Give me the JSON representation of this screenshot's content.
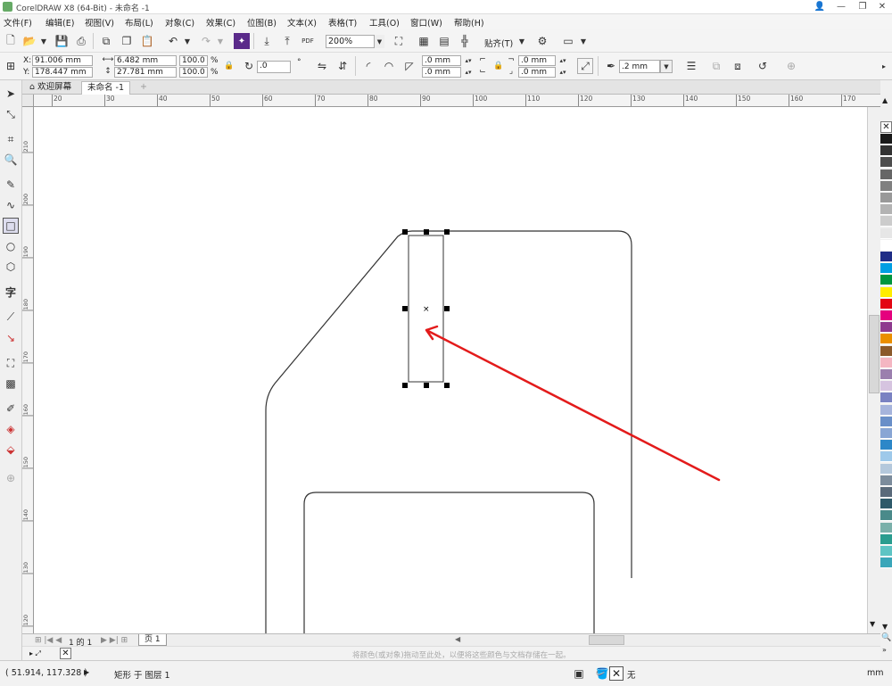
{
  "window": {
    "title": "CorelDRAW X8 (64-Bit) - 未命名 -1"
  },
  "menu": [
    "文件(F)",
    "编辑(E)",
    "视图(V)",
    "布局(L)",
    "对象(C)",
    "效果(C)",
    "位图(B)",
    "文本(X)",
    "表格(T)",
    "工具(O)",
    "窗口(W)",
    "帮助(H)"
  ],
  "toolbar": {
    "zoom": "200%",
    "snap_label": "贴齐(T)",
    "pdf_label": "PDF"
  },
  "properties": {
    "x_label": "X:",
    "x": "91.006 mm",
    "y_label": "Y:",
    "y": "178.447 mm",
    "w": "6.482 mm",
    "h": "27.781 mm",
    "scale_w": "100.0",
    "scale_h": "100.0",
    "pct": "%",
    "rotation": ".0",
    "corner_a": ".0 mm",
    "corner_b": ".0 mm",
    "corner_c": ".0 mm",
    "corner_d": ".0 mm",
    "outline": ".2 mm"
  },
  "tabs": {
    "welcome": "欢迎屏幕",
    "document": "未命名 -1"
  },
  "ruler": {
    "h_ticks": [
      "20",
      "30",
      "40",
      "50",
      "60",
      "70",
      "80",
      "90",
      "100",
      "110",
      "120",
      "130",
      "140",
      "150",
      "160",
      "170"
    ],
    "v_ticks": [
      "210",
      "200",
      "190",
      "180",
      "170",
      "160",
      "150",
      "140",
      "130",
      "120"
    ]
  },
  "pagenav": {
    "page_count": "1 的 1",
    "page_tab": "页 1"
  },
  "hint": "将颜色(或对象)拖动至此处，以便将这些颜色与文档存储在一起。",
  "status": {
    "coords": "( 51.914, 117.328 )",
    "object": "矩形 于 图层 1",
    "fill": "无",
    "unit": "mm"
  },
  "palette_colors": [
    "#1a1a1a",
    "#333333",
    "#4d4d4d",
    "#666666",
    "#808080",
    "#999999",
    "#b3b3b3",
    "#cccccc",
    "#e6e6e6",
    "#ffffff",
    "#1f2d86",
    "#009fe3",
    "#00963f",
    "#ffed00",
    "#e30613",
    "#e5007e",
    "#8e3a8e",
    "#ea8f00",
    "#8b5a2b",
    "#f4b6c2",
    "#9b7fae",
    "#d6c4e0",
    "#7a82c2",
    "#a6b4dc",
    "#6a8fc8",
    "#89a6d4",
    "#2d87c8",
    "#9ec9ea",
    "#b4c8dc",
    "#7c8c9c",
    "#5a6a7a",
    "#2e5a6a",
    "#4a8a8a",
    "#7ab0aa",
    "#2a9d8f",
    "#5ec4c4",
    "#3aa6b9"
  ]
}
